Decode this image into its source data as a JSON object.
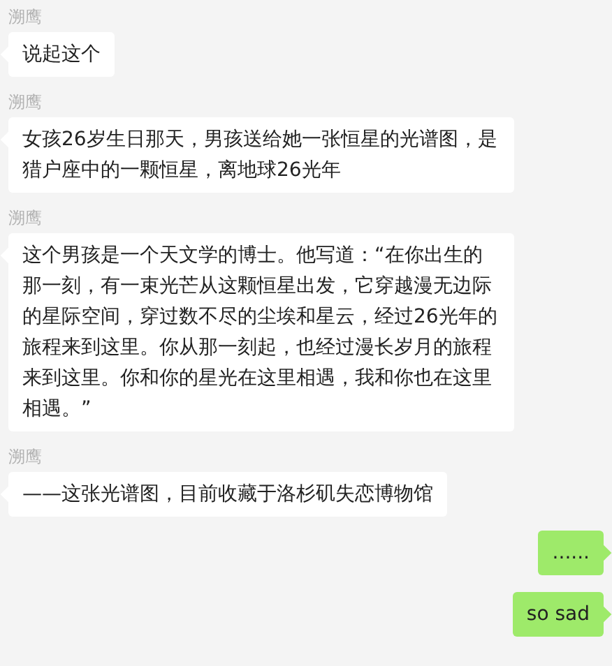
{
  "messages": [
    {
      "kind": "received",
      "sender": "溯鹰",
      "text": "说起这个"
    },
    {
      "kind": "received",
      "sender": "溯鹰",
      "text": "女孩26岁生日那天，男孩送给她一张恒星的光谱图，是猎户座中的一颗恒星，离地球26光年"
    },
    {
      "kind": "received",
      "sender": "溯鹰",
      "text": "这个男孩是一个天文学的博士。他写道：“在你出生的那一刻，有一束光芒从这颗恒星出发，它穿越漫无边际的星际空间，穿过数不尽的尘埃和星云，经过26光年的旅程来到这里。你从那一刻起，也经过漫长岁月的旅程来到这里。你和你的星光在这里相遇，我和你也在这里相遇。”"
    },
    {
      "kind": "received",
      "sender": "溯鹰",
      "text": "——这张光谱图，目前收藏于洛杉矶失恋博物馆"
    },
    {
      "kind": "sent",
      "text": "......"
    },
    {
      "kind": "sent",
      "text": "so sad"
    }
  ]
}
